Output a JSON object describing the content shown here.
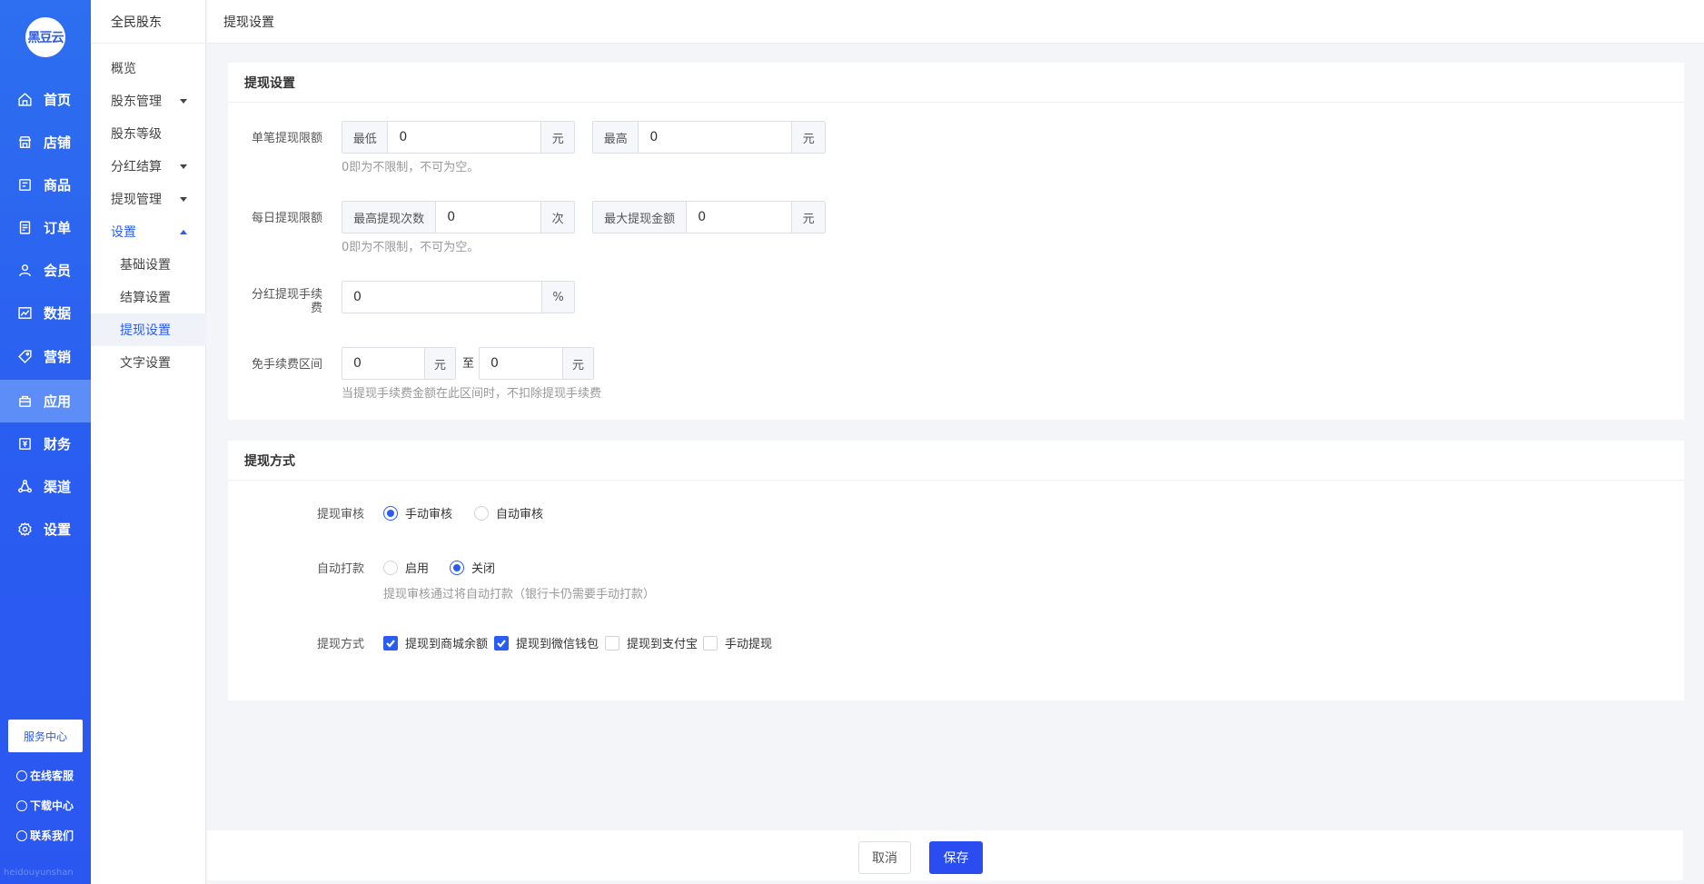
{
  "nav": {
    "logo_text": "黑豆云",
    "items": [
      {
        "label": "首页",
        "icon": "home-icon"
      },
      {
        "label": "店铺",
        "icon": "store-icon"
      },
      {
        "label": "商品",
        "icon": "goods-icon"
      },
      {
        "label": "订单",
        "icon": "order-icon"
      },
      {
        "label": "会员",
        "icon": "user-icon"
      },
      {
        "label": "数据",
        "icon": "chart-icon"
      },
      {
        "label": "营销",
        "icon": "tag-icon"
      },
      {
        "label": "应用",
        "icon": "app-icon"
      },
      {
        "label": "财务",
        "icon": "finance-icon"
      },
      {
        "label": "渠道",
        "icon": "channel-icon"
      },
      {
        "label": "设置",
        "icon": "gear-icon"
      }
    ],
    "active_index": 7,
    "service_center": "服务中心",
    "online_service": "在线客服",
    "download_center": "下载中心",
    "contact_us": "联系我们",
    "watermark": "heidouyunshan"
  },
  "side": {
    "title": "全民股东",
    "items": [
      "概览",
      "股东管理",
      "股东等级",
      "分红结算",
      "提现管理",
      "设置"
    ],
    "sub_items": [
      "基础设置",
      "结算设置",
      "提现设置",
      "文字设置"
    ],
    "active_sub_index": 2
  },
  "topbar": {
    "title": "提现设置"
  },
  "settings": {
    "title": "提现设置",
    "single_limit": {
      "label": "单笔提现限额",
      "min_prefix": "最低",
      "min_value": "0",
      "min_suffix": "元",
      "max_prefix": "最高",
      "max_value": "0",
      "max_suffix": "元",
      "hint": "0即为不限制，不可为空。"
    },
    "daily_limit": {
      "label": "每日提现限额",
      "count_prefix": "最高提现次数",
      "count_value": "0",
      "count_suffix": "次",
      "amount_prefix": "最大提现金额",
      "amount_value": "0",
      "amount_suffix": "元",
      "hint": "0即为不限制，不可为空。"
    },
    "fee": {
      "label_line1": "分红提现手续",
      "label_line2": "费",
      "value": "0",
      "suffix": "%"
    },
    "free_range": {
      "label": "免手续费区间",
      "from_value": "0",
      "from_suffix": "元",
      "to_text": "至",
      "to_value": "0",
      "to_suffix": "元",
      "hint": "当提现手续费金额在此区间时，不扣除提现手续费"
    }
  },
  "methods": {
    "title": "提现方式",
    "review": {
      "label": "提现审核",
      "options": [
        "手动审核",
        "自动审核"
      ],
      "selected": 0
    },
    "auto_pay": {
      "label": "自动打款",
      "options": [
        "启用",
        "关闭"
      ],
      "selected": 1,
      "hint": "提现审核通过将自动打款（银行卡仍需要手动打款）"
    },
    "method": {
      "label": "提现方式",
      "options": [
        "提现到商城余额",
        "提现到微信钱包",
        "提现到支付宝",
        "手动提现"
      ],
      "checked": [
        true,
        true,
        false,
        false
      ]
    }
  },
  "footer": {
    "cancel": "取消",
    "save": "保存"
  },
  "colors": {
    "primary": "#2a5cf1",
    "nav_active": "#5d8df7"
  }
}
